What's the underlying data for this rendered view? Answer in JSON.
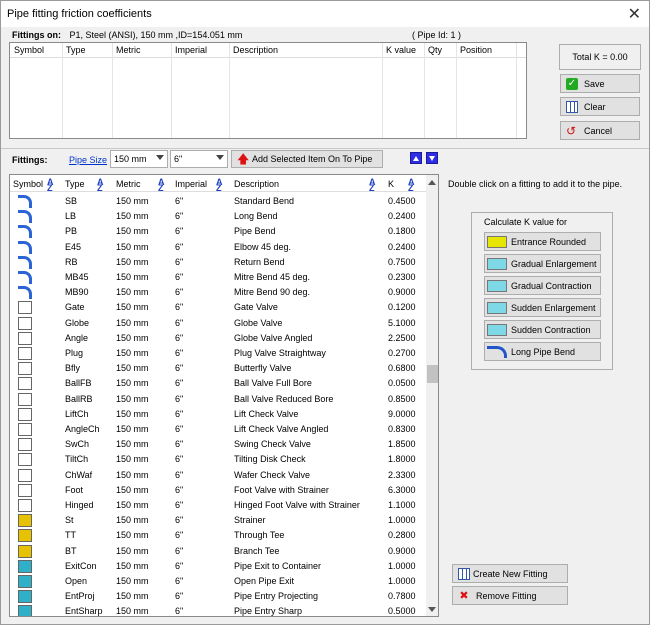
{
  "window": {
    "title": "Pipe fitting friction coefficients"
  },
  "header": {
    "fittings_on_label": "Fittings on:",
    "pipe_info": "P1, Steel (ANSI), 150 mm ,ID=154.051 mm",
    "pipe_id": "( Pipe Id: 1 )"
  },
  "top_table": {
    "columns": [
      "Symbol",
      "Type",
      "Metric",
      "Imperial",
      "Description",
      "K value",
      "Qty",
      "Position"
    ]
  },
  "side": {
    "total_k": "Total K = 0.00",
    "save": "Save",
    "clear": "Clear",
    "cancel": "Cancel"
  },
  "toolbar": {
    "fittings_label": "Fittings:",
    "pipe_size_link": "Pipe Size",
    "metric_value": "150 mm",
    "imperial_value": "6\"",
    "add_button": "Add Selected Item On To Pipe"
  },
  "list": {
    "columns": [
      "Symbol",
      "Type",
      "Metric",
      "Imperial",
      "Description",
      "K"
    ],
    "rows": [
      {
        "type": "SB",
        "metric": "150 mm",
        "imperial": "6\"",
        "desc": "Standard Bend",
        "k": "0.4500",
        "icon": "standard-bend-icon"
      },
      {
        "type": "LB",
        "metric": "150 mm",
        "imperial": "6\"",
        "desc": "Long Bend",
        "k": "0.2400",
        "icon": "long-bend-icon"
      },
      {
        "type": "PB",
        "metric": "150 mm",
        "imperial": "6\"",
        "desc": "Pipe Bend",
        "k": "0.1800",
        "icon": "pipe-bend-icon"
      },
      {
        "type": "E45",
        "metric": "150 mm",
        "imperial": "6\"",
        "desc": "Elbow 45 deg.",
        "k": "0.2400",
        "icon": "elbow-45-icon"
      },
      {
        "type": "RB",
        "metric": "150 mm",
        "imperial": "6\"",
        "desc": "Return Bend",
        "k": "0.7500",
        "icon": "return-bend-icon"
      },
      {
        "type": "MB45",
        "metric": "150 mm",
        "imperial": "6\"",
        "desc": "Mitre Bend 45 deg.",
        "k": "0.2300",
        "icon": "mitre-bend-45-icon"
      },
      {
        "type": "MB90",
        "metric": "150 mm",
        "imperial": "6\"",
        "desc": "Mitre Bend 90 deg.",
        "k": "0.9000",
        "icon": "mitre-bend-90-icon"
      },
      {
        "type": "Gate",
        "metric": "150 mm",
        "imperial": "6\"",
        "desc": "Gate Valve",
        "k": "0.1200",
        "icon": "gate-valve-icon"
      },
      {
        "type": "Globe",
        "metric": "150 mm",
        "imperial": "6\"",
        "desc": "Globe Valve",
        "k": "5.1000",
        "icon": "globe-valve-icon"
      },
      {
        "type": "Angle",
        "metric": "150 mm",
        "imperial": "6\"",
        "desc": "Globe Valve Angled",
        "k": "2.2500",
        "icon": "angle-valve-icon"
      },
      {
        "type": "Plug",
        "metric": "150 mm",
        "imperial": "6\"",
        "desc": "Plug Valve Straightway",
        "k": "0.2700",
        "icon": "plug-valve-icon"
      },
      {
        "type": "Bfly",
        "metric": "150 mm",
        "imperial": "6\"",
        "desc": "Butterfly Valve",
        "k": "0.6800",
        "icon": "butterfly-valve-icon"
      },
      {
        "type": "BallFB",
        "metric": "150 mm",
        "imperial": "6\"",
        "desc": "Ball Valve Full Bore",
        "k": "0.0500",
        "icon": "ball-valve-icon"
      },
      {
        "type": "BallRB",
        "metric": "150 mm",
        "imperial": "6\"",
        "desc": "Ball Valve Reduced Bore",
        "k": "0.8500",
        "icon": "ball-valve-reduced-icon"
      },
      {
        "type": "LiftCh",
        "metric": "150 mm",
        "imperial": "6\"",
        "desc": "Lift Check Valve",
        "k": "9.0000",
        "icon": "lift-check-icon"
      },
      {
        "type": "AngleCh",
        "metric": "150 mm",
        "imperial": "6\"",
        "desc": "Lift Check Valve Angled",
        "k": "0.8300",
        "icon": "angle-check-icon"
      },
      {
        "type": "SwCh",
        "metric": "150 mm",
        "imperial": "6\"",
        "desc": "Swing Check Valve",
        "k": "1.8500",
        "icon": "swing-check-icon"
      },
      {
        "type": "TiltCh",
        "metric": "150 mm",
        "imperial": "6\"",
        "desc": "Tilting Disk Check",
        "k": "1.8000",
        "icon": "tilting-disk-icon"
      },
      {
        "type": "ChWaf",
        "metric": "150 mm",
        "imperial": "6\"",
        "desc": "Wafer Check Valve",
        "k": "2.3300",
        "icon": "wafer-check-icon"
      },
      {
        "type": "Foot",
        "metric": "150 mm",
        "imperial": "6\"",
        "desc": "Foot Valve with Strainer",
        "k": "6.3000",
        "icon": "foot-valve-icon"
      },
      {
        "type": "Hinged",
        "metric": "150 mm",
        "imperial": "6\"",
        "desc": "Hinged Foot Valve with Strainer",
        "k": "1.1000",
        "icon": "hinged-foot-valve-icon"
      },
      {
        "type": "St",
        "metric": "150 mm",
        "imperial": "6\"",
        "desc": "Strainer",
        "k": "1.0000",
        "icon": "strainer-icon"
      },
      {
        "type": "TT",
        "metric": "150 mm",
        "imperial": "6\"",
        "desc": "Through Tee",
        "k": "0.2800",
        "icon": "through-tee-icon"
      },
      {
        "type": "BT",
        "metric": "150 mm",
        "imperial": "6\"",
        "desc": "Branch Tee",
        "k": "0.9000",
        "icon": "branch-tee-icon"
      },
      {
        "type": "ExitCon",
        "metric": "150 mm",
        "imperial": "6\"",
        "desc": "Pipe Exit to Container",
        "k": "1.0000",
        "icon": "exit-container-icon"
      },
      {
        "type": "Open",
        "metric": "150 mm",
        "imperial": "6\"",
        "desc": "Open Pipe Exit",
        "k": "1.0000",
        "icon": "open-exit-icon"
      },
      {
        "type": "EntProj",
        "metric": "150 mm",
        "imperial": "6\"",
        "desc": "Pipe Entry Projecting",
        "k": "0.7800",
        "icon": "entry-projecting-icon"
      },
      {
        "type": "EntSharp",
        "metric": "150 mm",
        "imperial": "6\"",
        "desc": "Pipe Entry Sharp",
        "k": "0.5000",
        "icon": "entry-sharp-icon"
      }
    ]
  },
  "right": {
    "hint": "Double click on a fitting to add it to the pipe.",
    "calc_title": "Calculate K value for",
    "calc_buttons": [
      "Entrance Rounded",
      "Gradual Enlargement",
      "Gradual Contraction",
      "Sudden Enlargement",
      "Sudden Contraction",
      "Long Pipe Bend"
    ],
    "create_fitting": "Create New Fitting",
    "remove_fitting": "Remove Fitting"
  }
}
